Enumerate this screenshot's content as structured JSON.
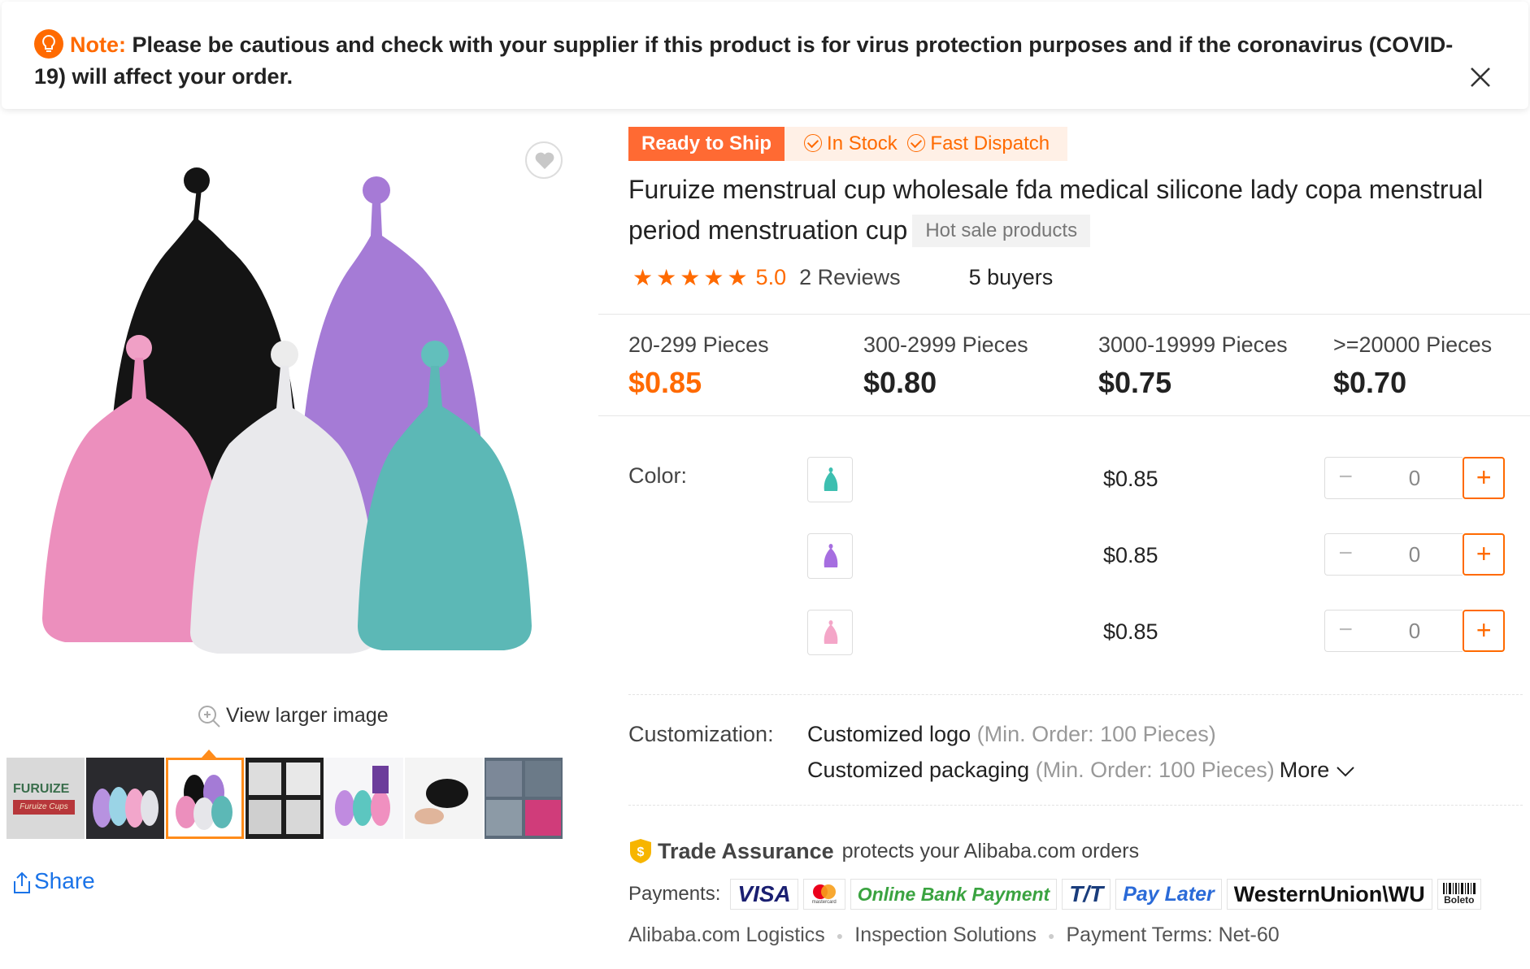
{
  "notice": {
    "label": "Note:",
    "text": " Please be cautious and check with your supplier if this product is for virus protection purposes and if the coronavirus (COVID-19) will affect your order."
  },
  "gallery": {
    "view_larger": "View larger image",
    "share": "Share",
    "thumbnail_brand": "FURUIZE",
    "thumbnail_brand_sub": "Furuize Cups"
  },
  "badges": {
    "ready": "Ready to Ship",
    "in_stock": "In Stock",
    "fast_dispatch": "Fast Dispatch"
  },
  "product": {
    "title": "Furuize menstrual cup wholesale fda medical silicone lady copa menstrual period menstruation cup",
    "hot_tag": "Hot sale products",
    "rating": "5.0",
    "stars": 5,
    "reviews": "2 Reviews",
    "buyers": "5 buyers"
  },
  "price_tiers": [
    {
      "qty": "20-299 Pieces",
      "price": "$0.85"
    },
    {
      "qty": "300-2999 Pieces",
      "price": "$0.80"
    },
    {
      "qty": "3000-19999 Pieces",
      "price": "$0.75"
    },
    {
      "qty": ">=20000 Pieces",
      "price": "$0.70"
    }
  ],
  "variants": {
    "label": "Color:",
    "items": [
      {
        "color": "#3dbfb0",
        "price": "$0.85",
        "qty": "0"
      },
      {
        "color": "#a66ee0",
        "price": "$0.85",
        "qty": "0"
      },
      {
        "color": "#f4a6c8",
        "price": "$0.85",
        "qty": "0"
      }
    ],
    "minus": "−",
    "plus": "+"
  },
  "customization": {
    "label": "Customization:",
    "logo": "Customized logo",
    "logo_min": " (Min. Order: 100 Pieces)",
    "packaging": "Customized packaging",
    "packaging_min": " (Min. Order: 100 Pieces)",
    "more": "More"
  },
  "trade_assurance": {
    "title": "Trade Assurance",
    "text": "protects your Alibaba.com orders"
  },
  "payments": {
    "label": "Payments:",
    "visa": "VISA",
    "mastercard_sub": "mastercard",
    "online_bank": "Online Bank Payment",
    "tt": "T/T",
    "pay_later": "Pay Later",
    "western_union": "WesternUnion\\WU",
    "boleto": "Boleto"
  },
  "footer": {
    "logistics": "Alibaba.com Logistics",
    "inspection": "Inspection Solutions",
    "terms": "Payment Terms: Net-60"
  },
  "colors": {
    "accent": "#ff6a00",
    "link": "#1a73e8"
  }
}
